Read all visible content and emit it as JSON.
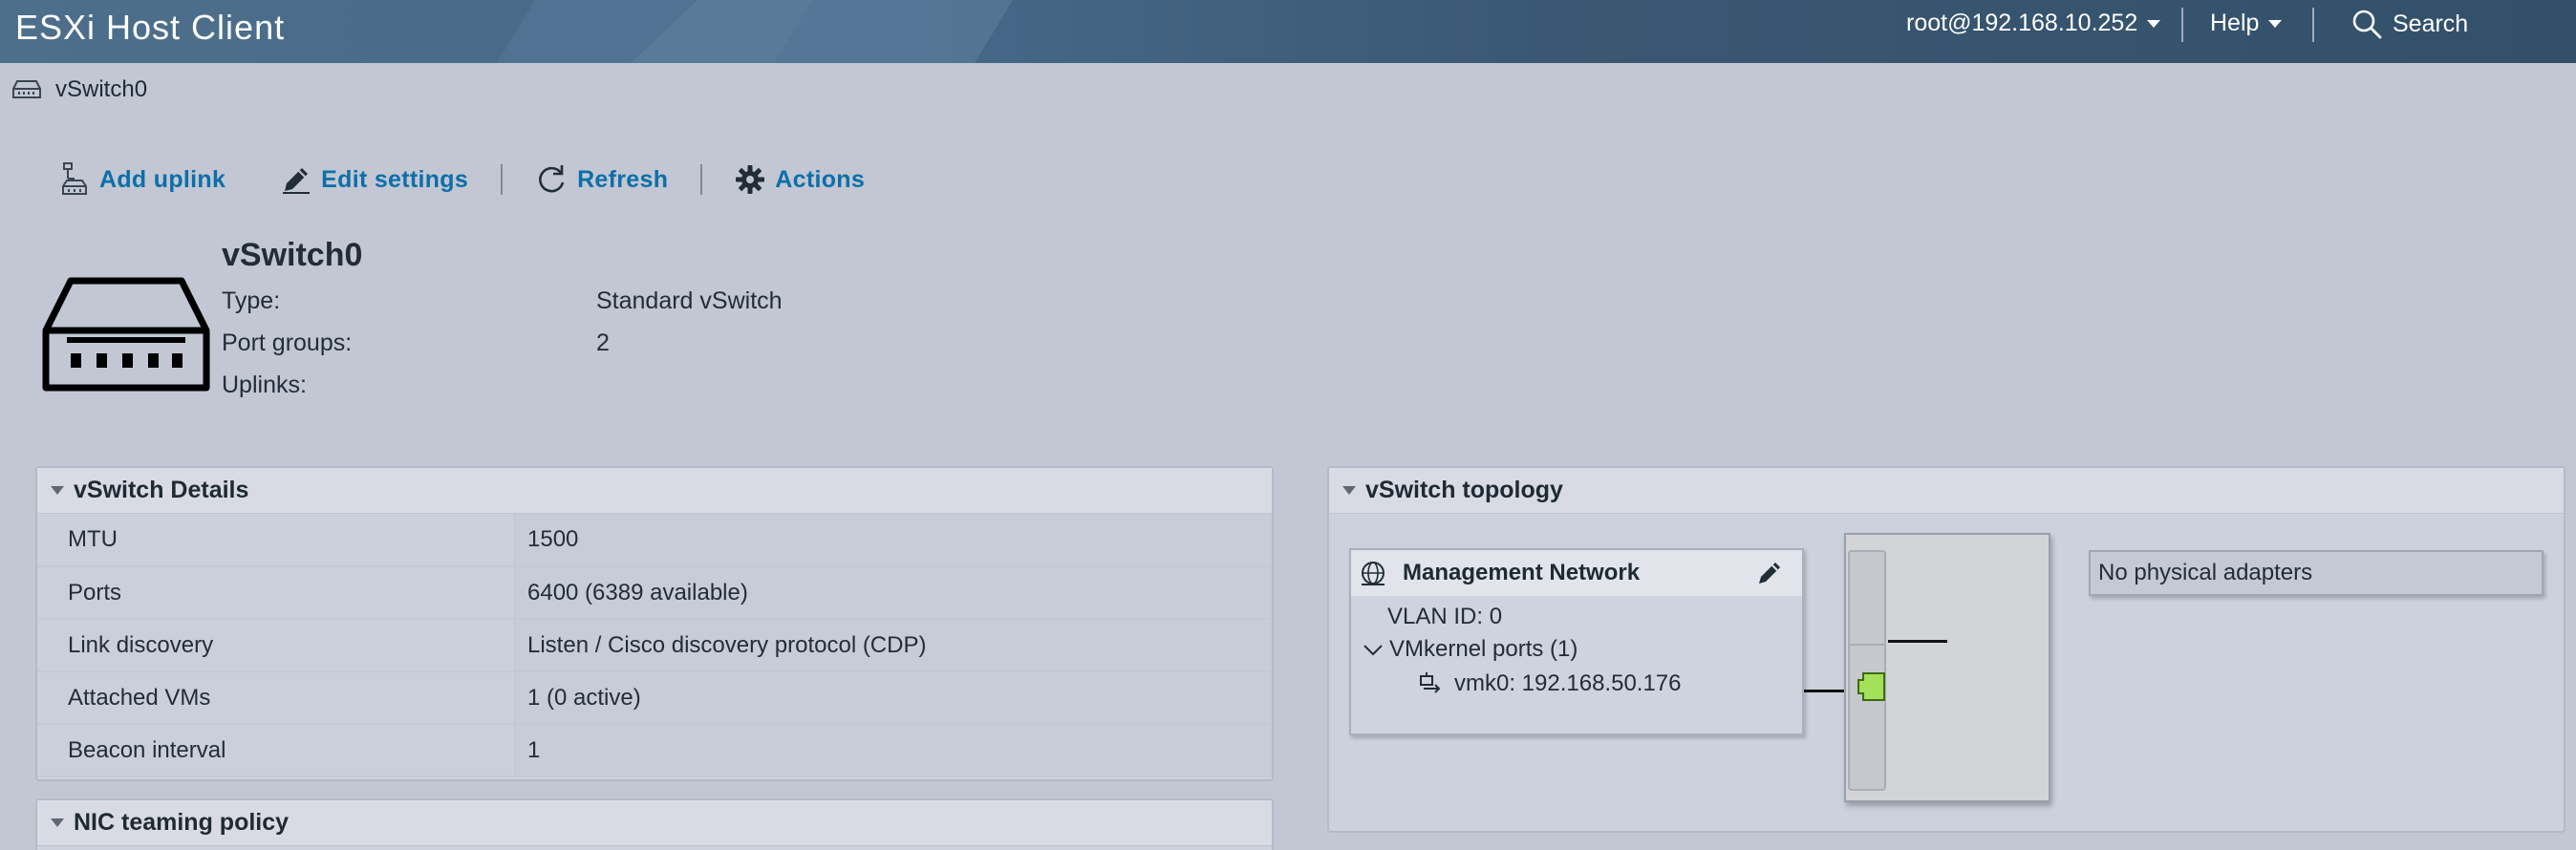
{
  "header": {
    "app_title": "ESXi Host Client",
    "user": "root@192.168.10.252",
    "help": "Help",
    "search": "Search"
  },
  "breadcrumb": {
    "label": "vSwitch0"
  },
  "toolbar": {
    "add_uplink": "Add uplink",
    "edit_settings": "Edit settings",
    "refresh": "Refresh",
    "actions": "Actions"
  },
  "summary": {
    "title": "vSwitch0",
    "rows": [
      {
        "key": "Type:",
        "value": "Standard vSwitch"
      },
      {
        "key": "Port groups:",
        "value": "2"
      },
      {
        "key": "Uplinks:",
        "value": ""
      }
    ]
  },
  "details": {
    "title": "vSwitch Details",
    "rows": [
      {
        "key": "MTU",
        "value": "1500"
      },
      {
        "key": "Ports",
        "value": "6400 (6389 available)"
      },
      {
        "key": "Link discovery",
        "value": "Listen / Cisco discovery protocol (CDP)"
      },
      {
        "key": "Attached VMs",
        "value": "1 (0 active)"
      },
      {
        "key": "Beacon interval",
        "value": "1"
      }
    ]
  },
  "nic_teaming": {
    "title": "NIC teaming policy"
  },
  "topology": {
    "title": "vSwitch topology",
    "port_group": {
      "name": "Management Network",
      "vlan": "VLAN ID: 0",
      "vmkernel_ports": "VMkernel ports (1)",
      "vmk": "vmk0: 192.168.50.176"
    },
    "no_adapters": "No physical adapters",
    "port_color": "#a4e05a"
  }
}
